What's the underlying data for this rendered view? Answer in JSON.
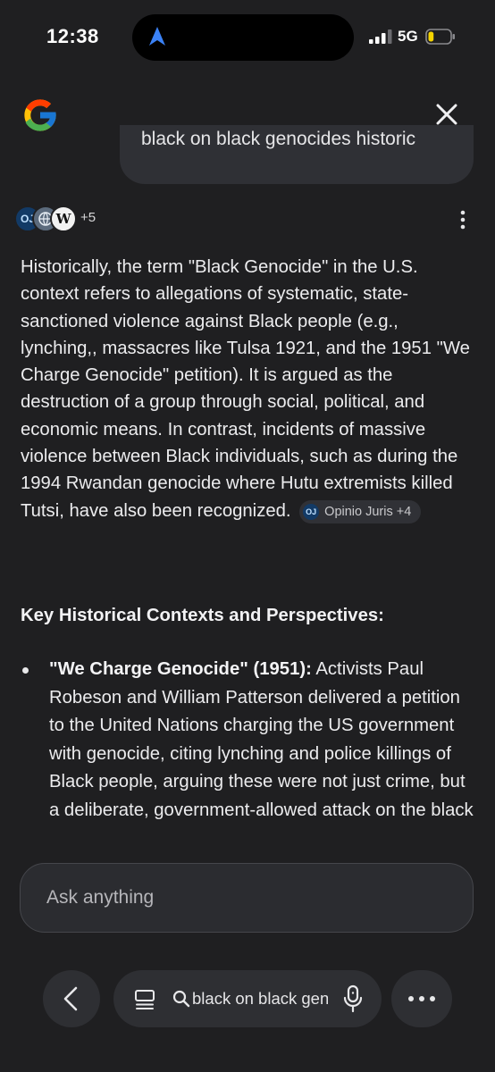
{
  "status_bar": {
    "time": "12:38",
    "network": "5G",
    "battery_level": 0.25,
    "icons": [
      "location-arrow-icon",
      "signal-icon",
      "battery-icon"
    ]
  },
  "header": {
    "logo_letter": "G",
    "close_icon": "close-icon"
  },
  "query": {
    "text": "black on black genocides historic"
  },
  "sources": {
    "badges": [
      "OJ",
      "",
      "W"
    ],
    "more_label": "+5"
  },
  "answer": {
    "paragraph": "Historically, the term \"Black Genocide\" in the U.S. context refers to allegations of systematic, state-sanctioned violence against Black people (e.g., lynching,, massacres like Tulsa 1921, and the 1951 \"We Charge Genocide\" petition). It is argued as the destruction of a group through social, political, and economic means. In contrast, incidents of massive violence between Black individuals, such as during the 1994 Rwandan genocide where Hutu extremists killed Tutsi, have also been recognized.",
    "citation": {
      "badge": "OJ",
      "label": "Opinio Juris +4"
    },
    "section_heading": "Key Historical Contexts and Perspectives:",
    "bullets": [
      {
        "title": "\"We Charge Genocide\" (1951):",
        "text": " Activists Paul Robeson and William Patterson delivered a petition to the United Nations charging the US government with genocide, citing lynching and police killings of Black people, arguing these were not just crime, but a deliberate, government-allowed attack on the black"
      }
    ]
  },
  "ask": {
    "placeholder": "Ask anything"
  },
  "bottom_nav": {
    "url_text": "black on black genocides historic",
    "icons": [
      "back-arrow-icon",
      "tabs-icon",
      "search-icon",
      "mic-icon",
      "more-icon"
    ]
  },
  "colors": {
    "background": "#1f1f21",
    "surface": "#2e2f33",
    "text": "#ececee",
    "accent_blue": "#3b82f6",
    "battery_yellow": "#f5d400"
  }
}
